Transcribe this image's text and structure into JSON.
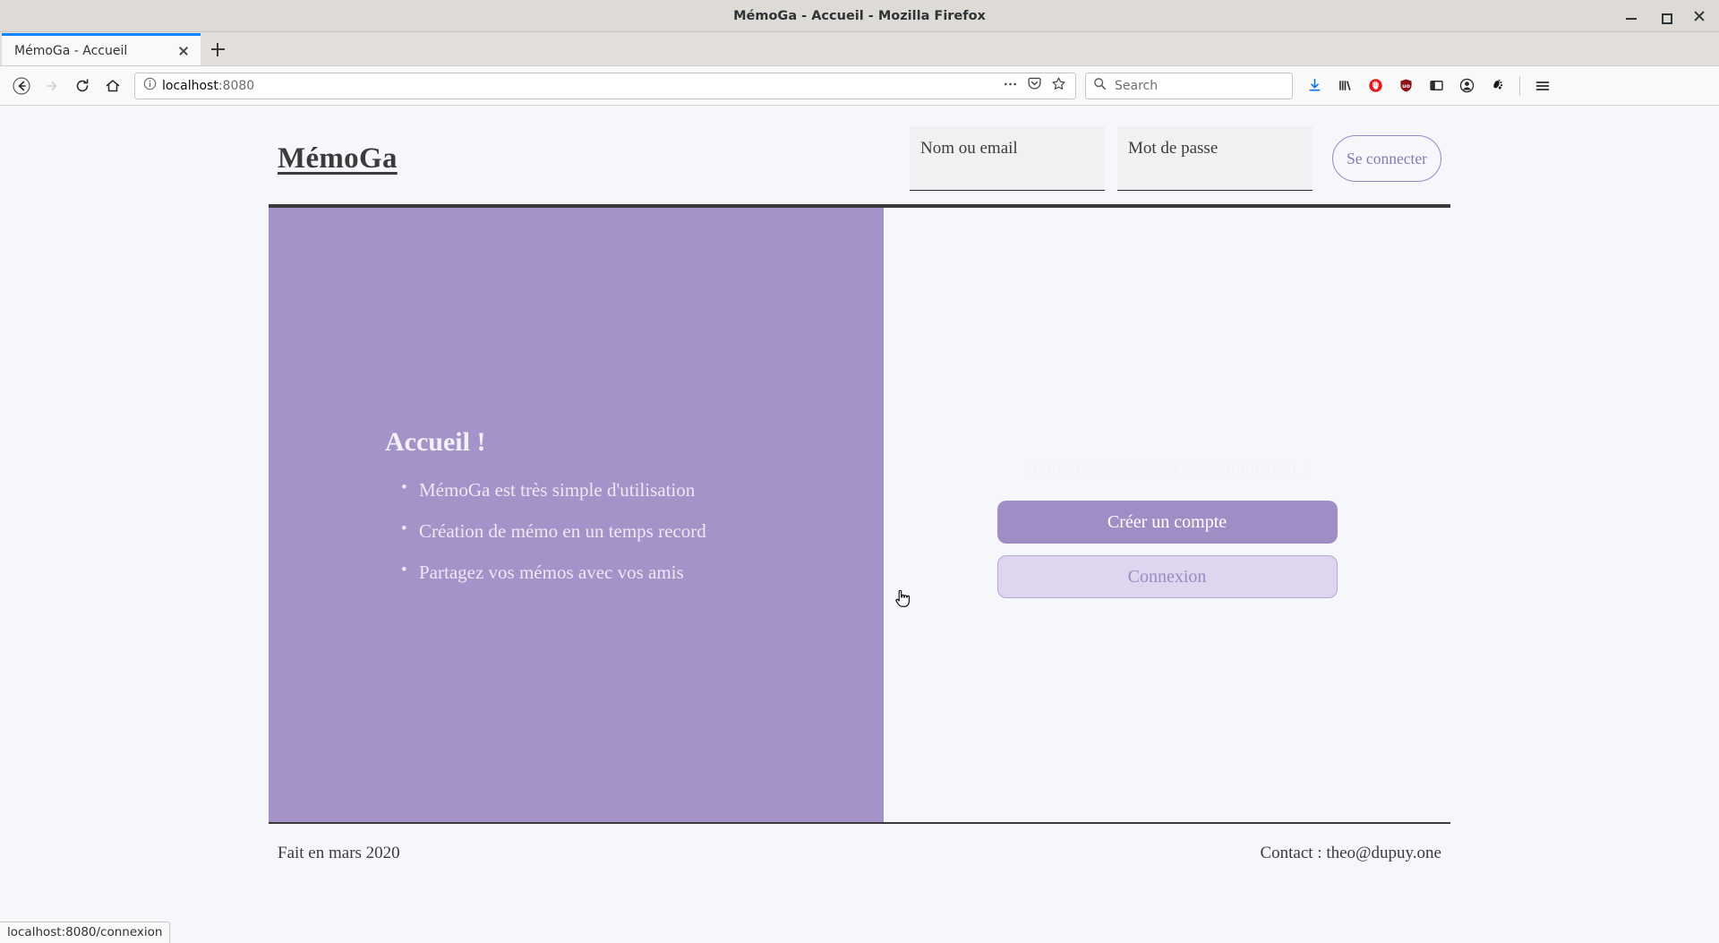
{
  "window": {
    "title": "MémoGa - Accueil - Mozilla Firefox",
    "minimize_label": "Minimize",
    "maximize_label": "Maximize",
    "close_label": "Close"
  },
  "browser": {
    "tab": {
      "label": "MémoGa - Accueil",
      "close_label": "Close tab"
    },
    "new_tab_label": "New tab",
    "nav": {
      "back": "back-arrow-icon",
      "forward": "forward-arrow-icon",
      "reload": "reload-icon",
      "home": "home-icon"
    },
    "url": {
      "host": "localhost",
      "port": ":8080",
      "full": "localhost:8080",
      "info_icon": "info-circle-icon",
      "page_actions_icon": "ellipsis-icon",
      "pocket_icon": "pocket-icon",
      "bookmark_icon": "star-icon"
    },
    "search": {
      "placeholder": "Search",
      "icon": "search-icon"
    },
    "toolbar_icons": [
      "downloads-icon",
      "library-icon",
      "adblock-icon",
      "ublock-shield-icon",
      "reader-sidebar-icon",
      "account-icon",
      "gnome-foot-icon",
      "hamburger-menu-icon"
    ],
    "status_bar": "localhost:8080/connexion"
  },
  "site": {
    "brand": "MémoGa",
    "login": {
      "name_placeholder": "Nom ou email",
      "password_placeholder": "Mot de passe",
      "submit_label": "Se connecter"
    },
    "left_panel": {
      "title": "Accueil !",
      "bullets": [
        "MémoGa est très simple d'utilisation",
        "Création de mémo en un temps record",
        "Partagez vos mémos avec vos amis"
      ]
    },
    "right_panel": {
      "join_text": "Rejoignez MémoGa dès aujourd'hui !",
      "signup_label": "Créer un compte",
      "login_label": "Connexion"
    },
    "footer": {
      "made": "Fait en mars 2020",
      "contact": "Contact : theo@dupuy.one"
    }
  },
  "colors": {
    "purple_panel": "#a592c8",
    "purple_button": "#a08dc6",
    "purple_button_light": "#ded6ef",
    "purple_text": "#8a77b5",
    "page_bg": "#f6f7fb",
    "tab_accent": "#0a84ff"
  }
}
